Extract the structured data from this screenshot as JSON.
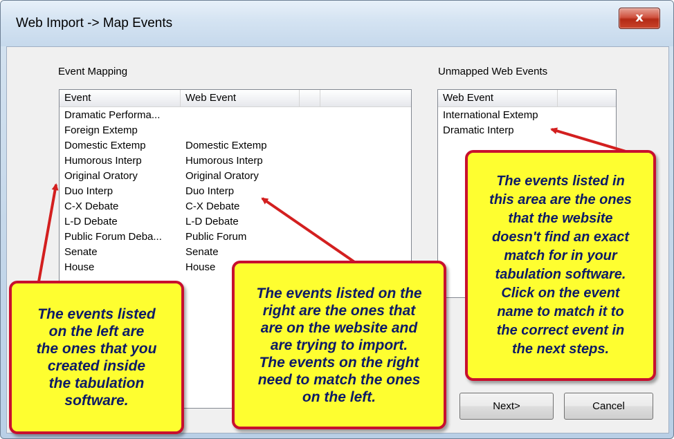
{
  "window": {
    "title": "Web Import -> Map Events",
    "close_glyph": "x"
  },
  "event_mapping": {
    "label": "Event Mapping",
    "columns": [
      "Event",
      "Web Event"
    ],
    "rows": [
      [
        "Dramatic Performa...",
        ""
      ],
      [
        "Foreign Extemp",
        ""
      ],
      [
        "Domestic Extemp",
        "Domestic Extemp"
      ],
      [
        "Humorous Interp",
        "Humorous Interp"
      ],
      [
        "Original Oratory",
        "Original Oratory"
      ],
      [
        "Duo Interp",
        "Duo Interp"
      ],
      [
        "C-X Debate",
        "C-X Debate"
      ],
      [
        "L-D Debate",
        "L-D Debate"
      ],
      [
        "Public Forum Deba...",
        "Public Forum"
      ],
      [
        "Senate",
        "Senate"
      ],
      [
        "House",
        "House"
      ]
    ]
  },
  "unmapped": {
    "label": "Unmapped Web Events",
    "columns": [
      "Web Event"
    ],
    "rows": [
      "International Extemp",
      "Dramatic Interp"
    ]
  },
  "buttons": {
    "next": "Next>",
    "cancel": "Cancel"
  },
  "callouts": {
    "left": "The events listed\non the left are\nthe ones that you\ncreated inside\nthe tabulation\nsoftware.",
    "middle": "The events listed on the\nright are the ones that\nare on the website and\nare trying to import.\nThe events on the right\nneed to match the ones\non the left.",
    "right": "The events listed in\nthis area are the ones\nthat the website\ndoesn't find an exact\nmatch for in your\ntabulation software.\nClick on the event\nname to match it to\nthe correct event in\nthe next steps."
  },
  "colors": {
    "callout_fill": "#fefe30",
    "callout_border": "#c8102e",
    "callout_text": "#0d1a66",
    "arrow": "#d31f1f"
  }
}
